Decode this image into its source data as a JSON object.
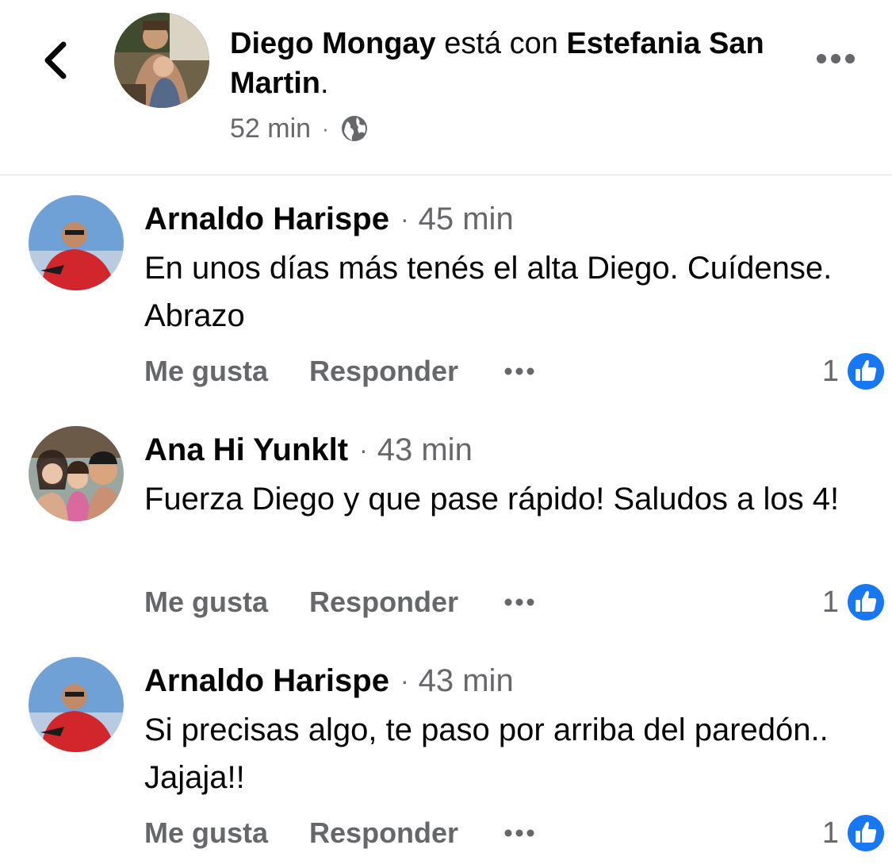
{
  "post_header": {
    "author": "Diego Mongay",
    "connector": " está con ",
    "tagged": "Estefania San Martin",
    "suffix": ".",
    "time": "52 min",
    "separator": "·",
    "audience_icon": "globe-icon",
    "back_icon": "chevron-left-icon",
    "more_icon": "more-horizontal-icon"
  },
  "comments": [
    {
      "author": "Arnaldo Harispe",
      "separator": "·",
      "time": "45 min",
      "text": "En unos días más tenés el alta Diego. Cuídense. Abrazo",
      "like_label": "Me gusta",
      "reply_label": "Responder",
      "reaction_count": "1",
      "reaction_icon": "like-reaction-icon"
    },
    {
      "author": "Ana Hi Yunklt",
      "separator": "·",
      "time": "43 min",
      "text": "Fuerza Diego y que pase rápido! Saludos a los 4!",
      "like_label": "Me gusta",
      "reply_label": "Responder",
      "reaction_count": "1",
      "reaction_icon": "like-reaction-icon"
    },
    {
      "author": "Arnaldo Harispe",
      "separator": "·",
      "time": "43 min",
      "text": "Si precisas algo, te paso por arriba del paredón.. Jajaja!!",
      "like_label": "Me gusta",
      "reply_label": "Responder",
      "reaction_count": "1",
      "reaction_icon": "like-reaction-icon"
    }
  ],
  "colors": {
    "text_primary": "#050505",
    "text_secondary": "#65676b",
    "like_blue": "#1877f2",
    "divider": "#dddfe2"
  }
}
